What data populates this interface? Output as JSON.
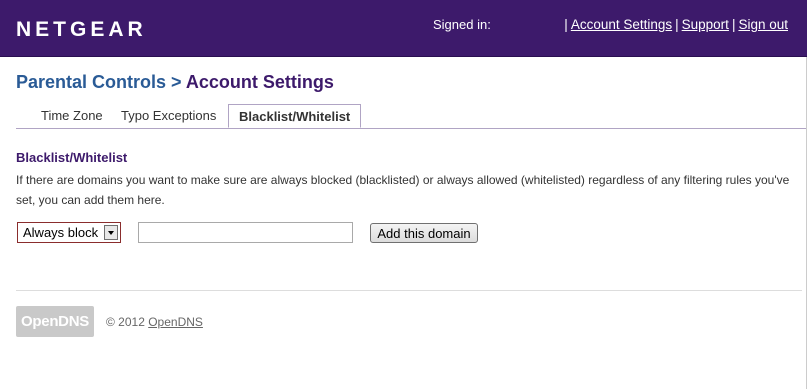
{
  "header": {
    "logo_text": "NETGEAR",
    "signed_in_label": "Signed in:",
    "links_prefix": "|",
    "separator": "|",
    "links": [
      "Account Settings",
      "Support",
      "Sign out"
    ]
  },
  "breadcrumb": {
    "parent": "Parental Controls",
    "separator": ">",
    "current": "Account Settings"
  },
  "tabs": [
    {
      "label": "Time Zone",
      "active": false
    },
    {
      "label": "Typo Exceptions",
      "active": false
    },
    {
      "label": "Blacklist/Whitelist",
      "active": true
    }
  ],
  "section": {
    "title": "Blacklist/Whitelist",
    "description": "If there are domains you want to make sure are always blocked (blacklisted) or always allowed (whitelisted) regardless of any filtering rules you've set, you can add them here."
  },
  "form": {
    "select_value": "Always block",
    "domain_value": "",
    "add_button_label": "Add this domain"
  },
  "footer": {
    "logo_text": "OpenDNS",
    "copyright_prefix": "© 2012",
    "copyright_link": "OpenDNS"
  },
  "colors": {
    "header_bg": "#3d1a6b",
    "breadcrumb_parent": "#2a5b96",
    "accent_purple": "#3d1a6b"
  }
}
